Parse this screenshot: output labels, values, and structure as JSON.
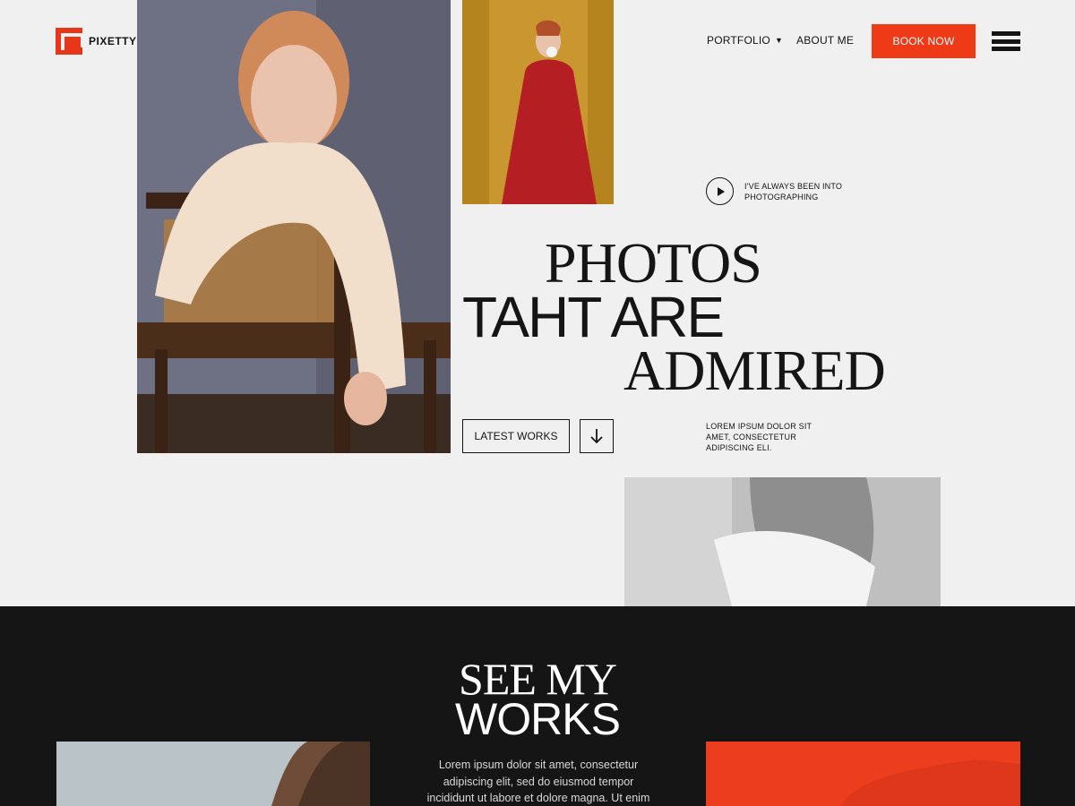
{
  "brand": {
    "name": "PIXETTY",
    "accent": "#ef3a17"
  },
  "nav": {
    "portfolio": "PORTFOLIO",
    "about": "ABOUT ME",
    "book": "BOOK NOW",
    "menu_icon": "hamburger-icon"
  },
  "hero": {
    "play_text": "I'VE ALWAYS BEEN INTO PHOTOGRAPHING",
    "headline": [
      "PHOTOS",
      "TAHT ARE",
      "ADMIRED"
    ],
    "latest_button": "LATEST WORKS",
    "arrow_icon": "arrow-down-icon",
    "side_text": "LOREM IPSUM DOLOR SIT AMET, CONSECTETUR ADIPISCING ELI."
  },
  "works": {
    "title_line1": "SEE MY",
    "title_line2": "WORKS",
    "text": "Lorem ipsum dolor sit amet, consectetur adipiscing elit, sed do eiusmod tempor incididunt ut labore et dolore magna. Ut enim ad minim"
  },
  "colors": {
    "background": "#eff0ef",
    "dark": "#151515",
    "text": "#141414"
  }
}
